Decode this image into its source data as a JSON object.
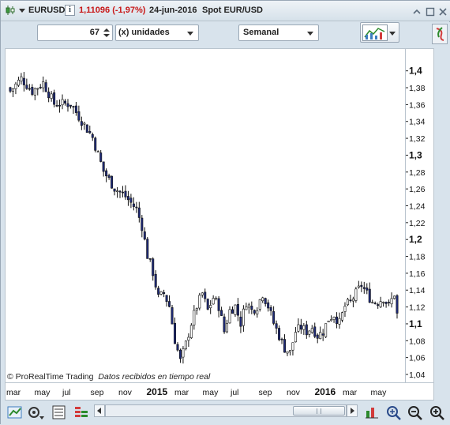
{
  "title_bar": {
    "symbol": "EURUSD",
    "info_badge": "i",
    "price_change": "1,11096 (-1,97%)",
    "date": "24-jun-2016",
    "instrument_name": "Spot EUR/USD"
  },
  "controls": {
    "units_value": "67",
    "units_label": "(x) unidades",
    "period_value": "Semanal"
  },
  "chart": {
    "copyright": "© ProRealTime Trading",
    "data_note": "Datos recibidos en tiempo real"
  },
  "colors": {
    "up_candle": "#ffffff",
    "down_candle": "#1e2a78",
    "price_change": "#cc0000",
    "accent": "#2f6fb3"
  },
  "chart_data": {
    "type": "candlestick",
    "instrument": "EURUSD",
    "timeframe": "Semanal",
    "ylim": [
      1.04,
      1.41
    ],
    "yticks": [
      1.04,
      1.06,
      1.08,
      1.1,
      1.12,
      1.14,
      1.16,
      1.18,
      1.2,
      1.22,
      1.24,
      1.26,
      1.28,
      1.3,
      1.32,
      1.34,
      1.36,
      1.38,
      1.4
    ],
    "yticks_labels": [
      "1,04",
      "1,06",
      "1,08",
      "1,1",
      "1,12",
      "1,14",
      "1,16",
      "1,18",
      "1,2",
      "1,22",
      "1,24",
      "1,26",
      "1,28",
      "1,3",
      "1,32",
      "1,34",
      "1,36",
      "1,38",
      "1,4"
    ],
    "yticks_bold": [
      "1,1",
      "1,2",
      "1,3",
      "1,4"
    ],
    "xticks": [
      {
        "label": "mar",
        "bold": false
      },
      {
        "label": "may",
        "bold": false
      },
      {
        "label": "jul",
        "bold": false
      },
      {
        "label": "sep",
        "bold": false
      },
      {
        "label": "nov",
        "bold": false
      },
      {
        "label": "2015",
        "bold": true
      },
      {
        "label": "mar",
        "bold": false
      },
      {
        "label": "may",
        "bold": false
      },
      {
        "label": "jul",
        "bold": false
      },
      {
        "label": "sep",
        "bold": false
      },
      {
        "label": "nov",
        "bold": false
      },
      {
        "label": "2016",
        "bold": true
      },
      {
        "label": "mar",
        "bold": false
      },
      {
        "label": "may",
        "bold": false
      }
    ],
    "anchors": [
      [
        0,
        1.375
      ],
      [
        4,
        1.39
      ],
      [
        8,
        1.375
      ],
      [
        12,
        1.385
      ],
      [
        16,
        1.36
      ],
      [
        22,
        1.36
      ],
      [
        26,
        1.34
      ],
      [
        30,
        1.32
      ],
      [
        34,
        1.28
      ],
      [
        38,
        1.26
      ],
      [
        42,
        1.25
      ],
      [
        46,
        1.235
      ],
      [
        48,
        1.215
      ],
      [
        50,
        1.18
      ],
      [
        52,
        1.16
      ],
      [
        54,
        1.13
      ],
      [
        56,
        1.135
      ],
      [
        58,
        1.12
      ],
      [
        60,
        1.08
      ],
      [
        62,
        1.055
      ],
      [
        64,
        1.075
      ],
      [
        66,
        1.1
      ],
      [
        68,
        1.12
      ],
      [
        70,
        1.135
      ],
      [
        72,
        1.115
      ],
      [
        74,
        1.13
      ],
      [
        76,
        1.12
      ],
      [
        78,
        1.09
      ],
      [
        80,
        1.115
      ],
      [
        82,
        1.12
      ],
      [
        84,
        1.1
      ],
      [
        86,
        1.125
      ],
      [
        88,
        1.115
      ],
      [
        90,
        1.12
      ],
      [
        92,
        1.135
      ],
      [
        94,
        1.12
      ],
      [
        96,
        1.1
      ],
      [
        98,
        1.085
      ],
      [
        100,
        1.07
      ],
      [
        102,
        1.065
      ],
      [
        104,
        1.09
      ],
      [
        106,
        1.095
      ],
      [
        108,
        1.09
      ],
      [
        110,
        1.095
      ],
      [
        112,
        1.085
      ],
      [
        114,
        1.09
      ],
      [
        116,
        1.105
      ],
      [
        118,
        1.11
      ],
      [
        120,
        1.1
      ],
      [
        122,
        1.12
      ],
      [
        124,
        1.125
      ],
      [
        126,
        1.135
      ],
      [
        128,
        1.145
      ],
      [
        130,
        1.135
      ],
      [
        132,
        1.125
      ],
      [
        134,
        1.125
      ],
      [
        136,
        1.13
      ],
      [
        138,
        1.12
      ],
      [
        140,
        1.135
      ],
      [
        141,
        1.11
      ]
    ],
    "bars": 142
  }
}
